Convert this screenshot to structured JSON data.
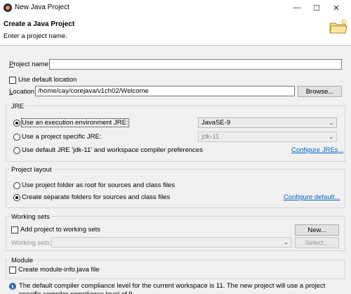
{
  "window": {
    "title": "New Java Project",
    "minimize": "—",
    "maximize": "☐",
    "close": "✕"
  },
  "header": {
    "title": "Create a Java Project",
    "message": "Enter a project name."
  },
  "project": {
    "name_label": "Project name:",
    "name_value": ""
  },
  "location": {
    "use_default_label": "Use default location",
    "use_default_checked": false,
    "label": "Location:",
    "value": "/home/cay/corejava/v1ch02/Welcome",
    "browse_label": "Browse..."
  },
  "jre": {
    "group_label": "JRE",
    "exec_env_label": "Use an execution environment JRE:",
    "exec_env_value": "JavaSE-9",
    "specific_label": "Use a project specific JRE:",
    "specific_value": "jdk-11",
    "default_label": "Use default JRE 'jdk-11' and workspace compiler preferences",
    "configure_link": "Configure JREs..."
  },
  "layout": {
    "group_label": "Project layout",
    "root_label": "Use project folder as root for sources and class files",
    "separate_label": "Create separate folders for sources and class files",
    "configure_link": "Configure default..."
  },
  "working_sets": {
    "group_label": "Working sets",
    "add_label": "Add project to working sets",
    "new_label": "New...",
    "sets_label": "Working sets:",
    "select_label": "Select..."
  },
  "module": {
    "group_label": "Module",
    "create_label": "Create module-info.java file"
  },
  "info": {
    "message": "The default compiler compliance level for the current workspace is 11. The new project will use a project specific compiler compliance level of 9."
  },
  "colors": {
    "link": "#0066cc",
    "dialog_bg": "#f0f0f0",
    "header_bg": "#ffffff"
  }
}
